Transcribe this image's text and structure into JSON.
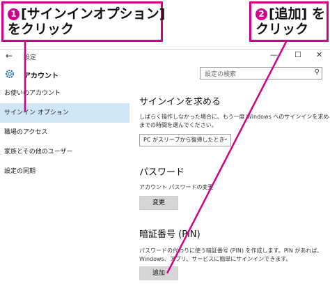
{
  "window": {
    "title": "設定",
    "back_glyph": "←",
    "minimize_glyph": "—",
    "maximize_glyph": "☐",
    "close_glyph": "✕",
    "section_title": "アカウント",
    "search_placeholder": "設定の検索",
    "search_glyph": "⚲"
  },
  "sidebar": {
    "items": [
      {
        "label": "お使いのアカウント"
      },
      {
        "label": "サインイン オプション",
        "selected": true
      },
      {
        "label": "職場のアクセス"
      },
      {
        "label": "家族とその他のユーザー"
      },
      {
        "label": "設定の同期"
      }
    ]
  },
  "main": {
    "signin_heading": "サインインを求める",
    "signin_desc_1": "しばらく操作しなかった場合に、もう一度 Windows へのサインインを求める",
    "signin_desc_2": "までの時間を選んでください。",
    "signin_dropdown": "PC がスリープから復帰したとき",
    "dropdown_glyph": "⌄",
    "password_heading": "パスワード",
    "password_desc": "アカウント パスワードの変更",
    "password_button": "変更",
    "pin_heading": "暗証番号 (PIN)",
    "pin_desc_1": "パスワードの代わりに使う暗証番号 (PIN) を作成します。PIN があれば、",
    "pin_desc_2": "Windows、アプリ、サービスに簡単にサインインできます。",
    "pin_button": "追加"
  },
  "callouts": {
    "c1_num": "1",
    "c1_line1": "[サインインオプション]",
    "c1_line2": "をクリック",
    "c2_num": "2",
    "c2_line1": "[追加] を",
    "c2_line2": "クリック",
    "color": "#d0008a"
  }
}
